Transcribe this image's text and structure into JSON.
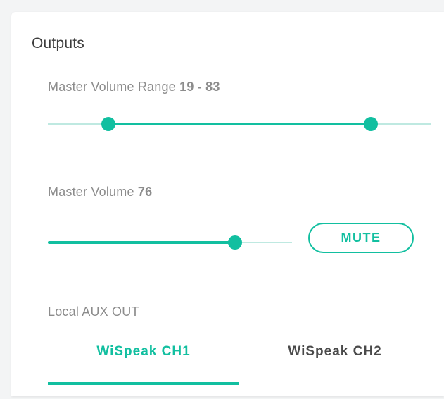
{
  "outputs": {
    "title": "Outputs",
    "master_range": {
      "label": "Master Volume Range",
      "min": 19,
      "max": 83,
      "value_text": "19 - 83"
    },
    "master_volume": {
      "label": "Master Volume",
      "value": 76,
      "value_text": "76"
    },
    "mute_label": "MUTE",
    "aux": {
      "label": "Local AUX OUT",
      "tabs": [
        {
          "label": "WiSpeak CH1",
          "selected": true
        },
        {
          "label": "WiSpeak CH2",
          "selected": false
        }
      ]
    }
  },
  "colors": {
    "accent": "#12bfa0",
    "accent_light": "#bfe9e1",
    "label_gray": "#8c8c8c",
    "title_gray": "#3d3d3d"
  }
}
